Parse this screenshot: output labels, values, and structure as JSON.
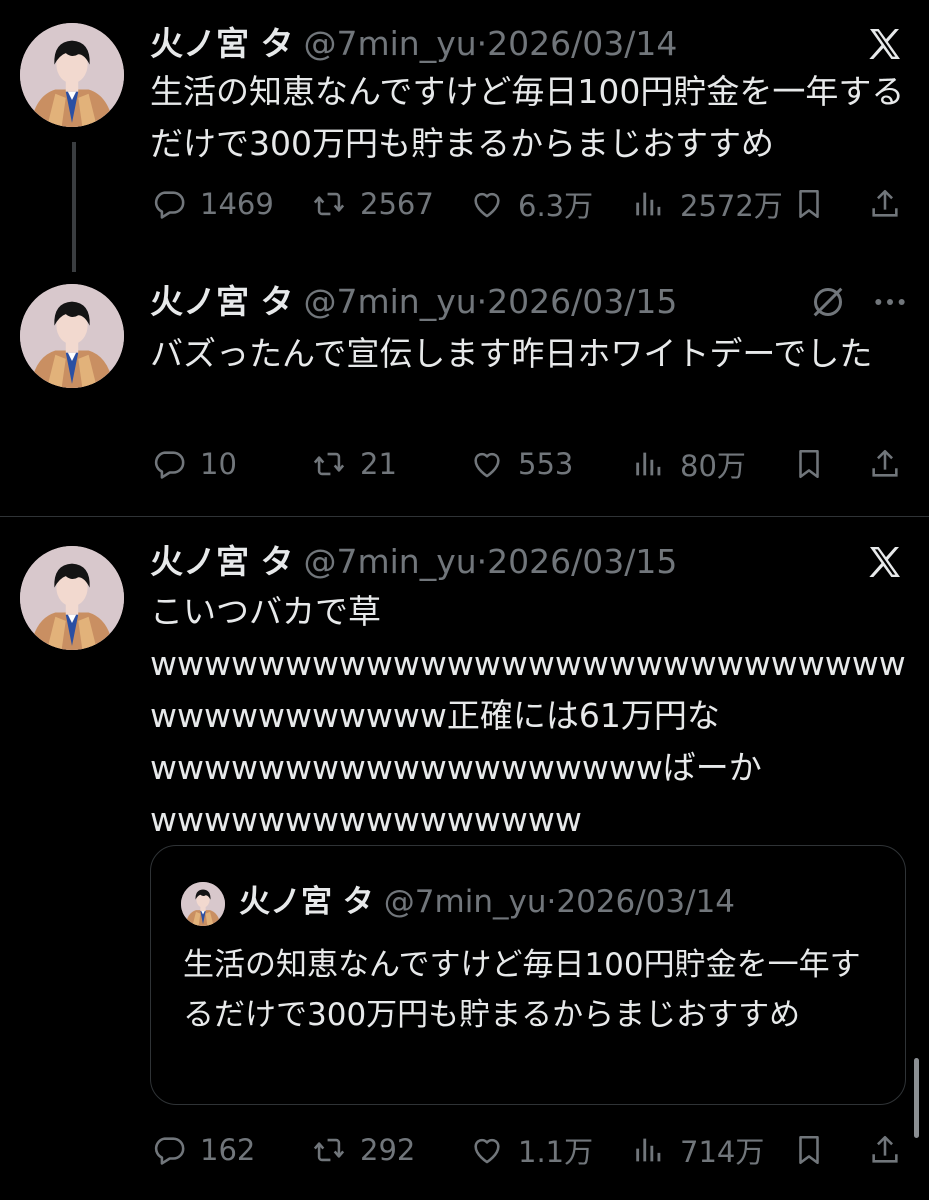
{
  "tweets": [
    {
      "name": "火ノ宮 タ",
      "handle": "@7min_yu",
      "dot": "·",
      "date": "2026/03/14",
      "corner_icon": "x-logo-icon",
      "text": "生活の知恵なんですけど毎日100円貯金を一年するだけで300万円も貯まるからまじおすすめ",
      "replies": "1469",
      "reposts": "2567",
      "likes": "6.3万",
      "views": "2572万"
    },
    {
      "name": "火ノ宮 タ",
      "handle": "@7min_yu",
      "dot": "·",
      "date": "2026/03/15",
      "corner_icon": "grok-icon",
      "more_icon": "more-icon",
      "text": "バズったんで宣伝します昨日ホワイトデーでした",
      "replies": "10",
      "reposts": "21",
      "likes": "553",
      "views": "80万"
    },
    {
      "name": "火ノ宮 タ",
      "handle": "@7min_yu",
      "dot": "·",
      "date": "2026/03/15",
      "corner_icon": "x-logo-icon",
      "text_lines": [
        "こいつバカで草",
        "wwwwwwwwwwwwwwwwwwwwwwwwwwwwwwwwwwwwwww正確には61万円な",
        "wwwwwwwwwwwwwwwwwwwばーか",
        "wwwwwwwwwwwwwwww"
      ],
      "quote": {
        "name": "火ノ宮 タ",
        "handle": "@7min_yu",
        "dot": "·",
        "date": "2026/03/14",
        "text": "生活の知恵なんですけど毎日100円貯金を一年するだけで300万円も貯まるからまじおすすめ"
      },
      "replies": "162",
      "reposts": "292",
      "likes": "1.1万",
      "views": "714万"
    }
  ],
  "icons": {
    "reply": "reply-icon",
    "repost": "repost-icon",
    "like": "heart-icon",
    "views": "views-icon",
    "bookmark": "bookmark-icon",
    "share": "share-icon"
  },
  "colors": {
    "background": "#000000",
    "text": "#e7e9ea",
    "muted": "#71767b",
    "border": "#2f3336"
  }
}
